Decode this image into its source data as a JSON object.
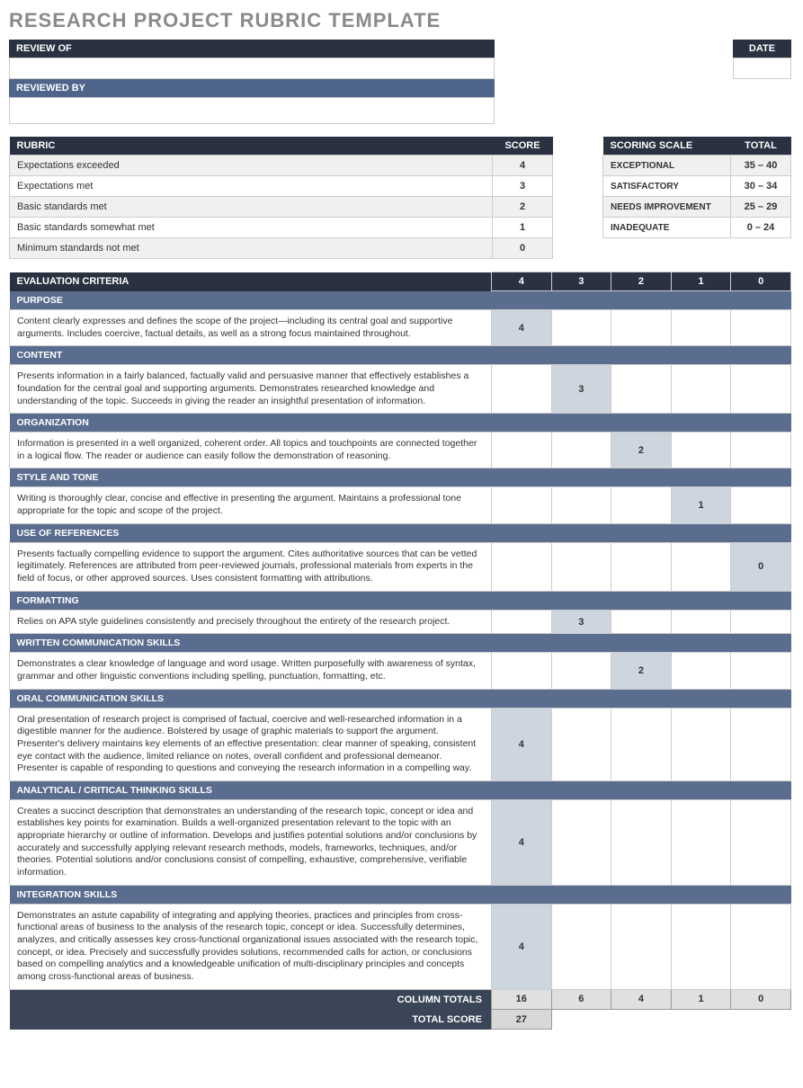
{
  "title": "RESEARCH PROJECT RUBRIC TEMPLATE",
  "meta": {
    "reviewOf": "REVIEW OF",
    "reviewedBy": "REVIEWED BY",
    "date": "DATE"
  },
  "rubric": {
    "header": "RUBRIC",
    "scoreHeader": "SCORE",
    "rows": [
      {
        "label": "Expectations exceeded",
        "score": "4"
      },
      {
        "label": "Expectations met",
        "score": "3"
      },
      {
        "label": "Basic standards met",
        "score": "2"
      },
      {
        "label": "Basic standards somewhat met",
        "score": "1"
      },
      {
        "label": "Minimum standards not met",
        "score": "0"
      }
    ]
  },
  "scale": {
    "header": "SCORING SCALE",
    "totalHeader": "TOTAL",
    "rows": [
      {
        "label": "EXCEPTIONAL",
        "range": "35 – 40"
      },
      {
        "label": "SATISFACTORY",
        "range": "30 – 34"
      },
      {
        "label": "NEEDS IMPROVEMENT",
        "range": "25 – 29"
      },
      {
        "label": "INADEQUATE",
        "range": "0 – 24"
      }
    ]
  },
  "eval": {
    "header": "EVALUATION CRITERIA",
    "cols": [
      "4",
      "3",
      "2",
      "1",
      "0"
    ],
    "criteria": [
      {
        "name": "PURPOSE",
        "desc": "Content clearly expresses and defines the scope of the project—including its central goal and supportive arguments. Includes coercive, factual details, as well as a strong focus maintained throughout.",
        "score": "4",
        "col": 0
      },
      {
        "name": "CONTENT",
        "desc": "Presents information in a fairly balanced, factually valid and persuasive manner that effectively establishes a foundation for the central goal and supporting arguments. Demonstrates researched knowledge and understanding of the topic. Succeeds in giving the reader an insightful presentation of information.",
        "score": "3",
        "col": 1
      },
      {
        "name": "ORGANIZATION",
        "desc": "Information is presented in a well organized, coherent order. All topics and touchpoints are connected together in a logical flow. The reader or audience can easily follow the demonstration of reasoning.",
        "score": "2",
        "col": 2
      },
      {
        "name": "STYLE AND TONE",
        "desc": "Writing is thoroughly clear, concise and effective in presenting the argument. Maintains a professional tone appropriate for the topic and scope of the project.",
        "score": "1",
        "col": 3
      },
      {
        "name": "USE OF REFERENCES",
        "desc": "Presents factually compelling evidence to support the argument. Cites authoritative sources that can be vetted legitimately. References are attributed from peer-reviewed journals, professional materials from experts in the field of focus, or other approved sources. Uses consistent formatting with attributions.",
        "score": "0",
        "col": 4
      },
      {
        "name": "FORMATTING",
        "desc": "Relies on APA style guidelines consistently and precisely throughout the entirety of the research project.",
        "score": "3",
        "col": 1
      },
      {
        "name": "WRITTEN COMMUNICATION SKILLS",
        "desc": "Demonstrates a clear knowledge of language and word usage. Written purposefully with awareness of syntax, grammar and other linguistic conventions including spelling, punctuation, formatting, etc.",
        "score": "2",
        "col": 2
      },
      {
        "name": "ORAL COMMUNICATION SKILLS",
        "desc": "Oral presentation of research project is comprised of factual, coercive and well-researched information in a digestible manner for the audience. Bolstered by usage of graphic materials to support the argument. Presenter's delivery maintains key elements of an effective presentation: clear manner of speaking, consistent eye contact with the audience, limited reliance on notes, overall confident and professional demeanor. Presenter is capable of responding to questions and conveying the research information in a compelling way.",
        "score": "4",
        "col": 0
      },
      {
        "name": "ANALYTICAL / CRITICAL THINKING SKILLS",
        "desc": "Creates a succinct description that demonstrates an understanding of the research topic, concept or idea and establishes key points for examination. Builds a well-organized presentation relevant to the topic with an appropriate hierarchy or outline of information. Develops and justifies potential solutions and/or conclusions by accurately and successfully applying relevant research methods, models, frameworks, techniques, and/or theories. Potential solutions and/or conclusions consist of compelling, exhaustive, comprehensive, verifiable information.",
        "score": "4",
        "col": 0
      },
      {
        "name": "INTEGRATION SKILLS",
        "desc": "Demonstrates an astute capability of integrating and applying theories, practices and principles from cross-functional areas of business to the analysis of the research topic, concept or idea. Successfully determines, analyzes, and critically assesses key cross-functional organizational issues associated with the research topic, concept, or idea. Precisely and successfully provides solutions, recommended calls for action, or conclusions based on compelling  analytics and a knowledgeable unification of multi-disciplinary principles and concepts among cross-functional areas of business.",
        "score": "4",
        "col": 0
      }
    ],
    "columnTotalsLabel": "COLUMN TOTALS",
    "columnTotals": [
      "16",
      "6",
      "4",
      "1",
      "0"
    ],
    "totalScoreLabel": "TOTAL SCORE",
    "totalScore": "27"
  }
}
